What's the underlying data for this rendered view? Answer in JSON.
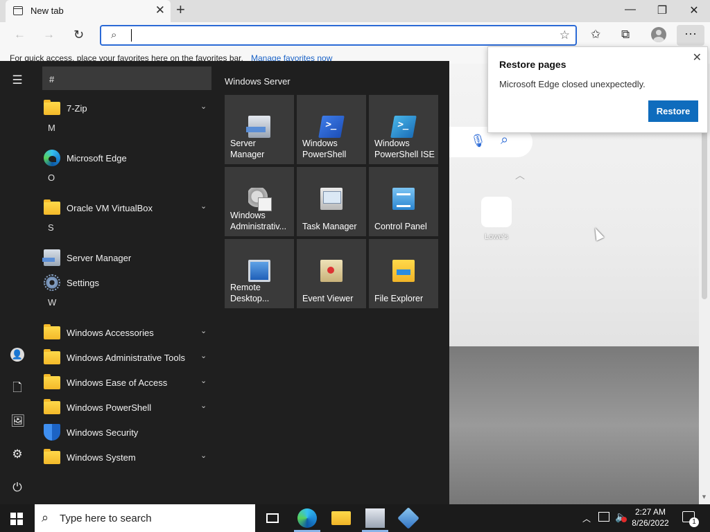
{
  "browser": {
    "tab_title": "New tab",
    "tab_close": "✕",
    "new_tab": "+",
    "window_controls": {
      "minimize": "—",
      "restore": "❐",
      "close": "✕"
    },
    "address_placeholder": "",
    "favorites_bar_text": "For quick access, place your favorites here on the favorites bar.",
    "favorites_bar_link": "Manage favorites now",
    "more_label": "···"
  },
  "restore_popup": {
    "title": "Restore pages",
    "message": "Microsoft Edge closed unexpectedly.",
    "button": "Restore",
    "close": "✕"
  },
  "new_tab_page": {
    "quick_link_label": "Lowe's"
  },
  "start_menu": {
    "hash_header": "#",
    "apps": [
      {
        "kind": "app",
        "label": "7-Zip",
        "icon": "folder-icon",
        "expandable": true
      },
      {
        "kind": "letter",
        "label": "M"
      },
      {
        "kind": "app",
        "label": "Microsoft Edge",
        "icon": "edge-icon",
        "expandable": false
      },
      {
        "kind": "letter",
        "label": "O"
      },
      {
        "kind": "app",
        "label": "Oracle VM VirtualBox",
        "icon": "folder-icon",
        "expandable": true
      },
      {
        "kind": "letter",
        "label": "S"
      },
      {
        "kind": "app",
        "label": "Server Manager",
        "icon": "server-manager-icon",
        "expandable": false
      },
      {
        "kind": "app",
        "label": "Settings",
        "icon": "gear-icon",
        "expandable": false
      },
      {
        "kind": "letter",
        "label": "W"
      },
      {
        "kind": "app",
        "label": "Windows Accessories",
        "icon": "folder-icon",
        "expandable": true
      },
      {
        "kind": "app",
        "label": "Windows Administrative Tools",
        "icon": "folder-icon",
        "expandable": true
      },
      {
        "kind": "app",
        "label": "Windows Ease of Access",
        "icon": "folder-icon",
        "expandable": true
      },
      {
        "kind": "app",
        "label": "Windows PowerShell",
        "icon": "folder-icon",
        "expandable": true
      },
      {
        "kind": "app",
        "label": "Windows Security",
        "icon": "shield-icon",
        "expandable": false
      },
      {
        "kind": "app",
        "label": "Windows System",
        "icon": "folder-icon",
        "expandable": true
      }
    ],
    "tiles_header": "Windows Server",
    "tiles": [
      {
        "label": "Server Manager",
        "icon": "server-manager-icon",
        "style": "t-srv"
      },
      {
        "label": "Windows PowerShell",
        "icon": "powershell-icon",
        "style": "t-ps"
      },
      {
        "label": "Windows PowerShell ISE",
        "icon": "powershell-ise-icon",
        "style": "t-psise"
      },
      {
        "label": "Windows Administrativ...",
        "icon": "admin-tools-icon",
        "style": "t-admin"
      },
      {
        "label": "Task Manager",
        "icon": "task-manager-icon",
        "style": "t-task"
      },
      {
        "label": "Control Panel",
        "icon": "control-panel-icon",
        "style": "t-cpl"
      },
      {
        "label": "Remote Desktop...",
        "icon": "remote-desktop-icon",
        "style": "t-rdp"
      },
      {
        "label": "Event Viewer",
        "icon": "event-viewer-icon",
        "style": "t-ev"
      },
      {
        "label": "File Explorer",
        "icon": "file-explorer-icon",
        "style": "t-fe"
      }
    ]
  },
  "taskbar": {
    "search_placeholder": "Type here to search",
    "clock_time": "2:27 AM",
    "clock_date": "8/26/2022",
    "notification_count": "1"
  },
  "colors": {
    "start_bg": "#1f1f1f",
    "tile_bg": "#3a3a3a",
    "accent": "#0f6cbd",
    "address_focus": "#2b6ad6"
  }
}
